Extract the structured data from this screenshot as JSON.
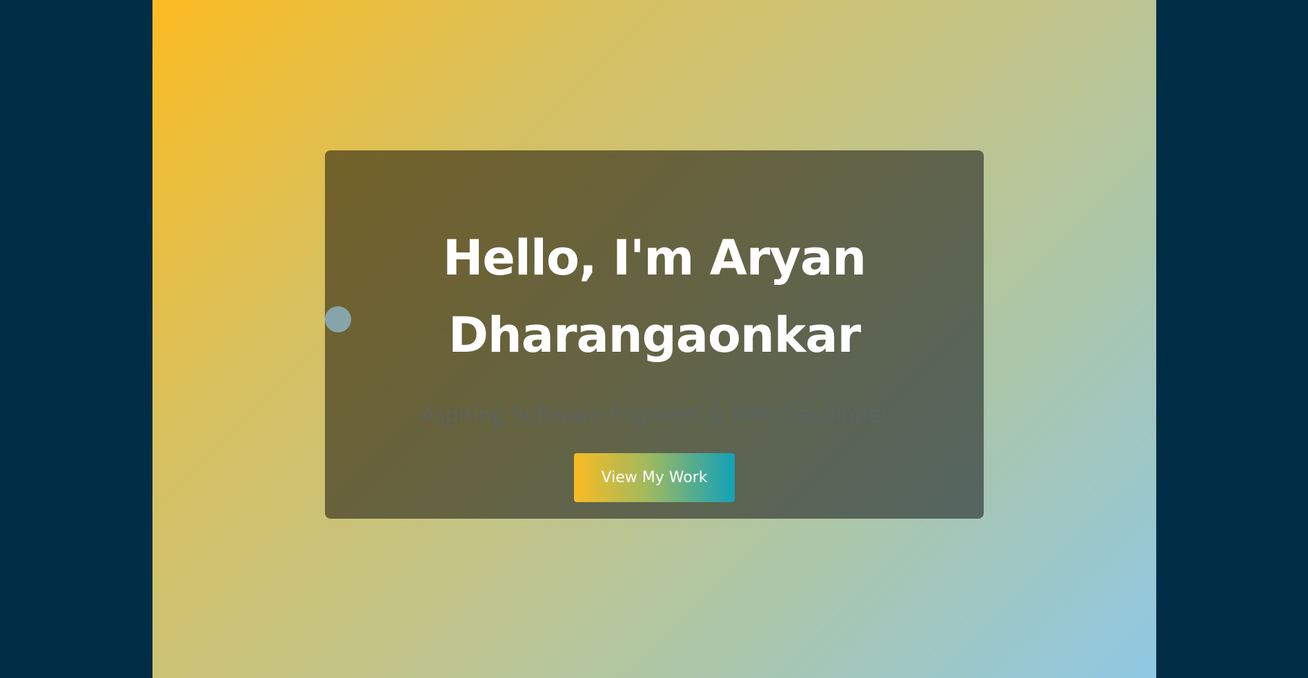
{
  "hero": {
    "title_line1": "Hello, I'm Aryan",
    "title_line2": "Dharangaonkar",
    "subtitle": "Aspiring Software Engineer & Web Developer",
    "cta_label": "View My Work"
  },
  "colors": {
    "page_background": "#002d46",
    "gradient_start": "#fcbc22",
    "gradient_end": "#8fc8e4",
    "card_background": "#675f36",
    "button_gradient_start": "#f9bb23",
    "button_gradient_end": "#11a1b8",
    "title_text": "#ffffff"
  }
}
